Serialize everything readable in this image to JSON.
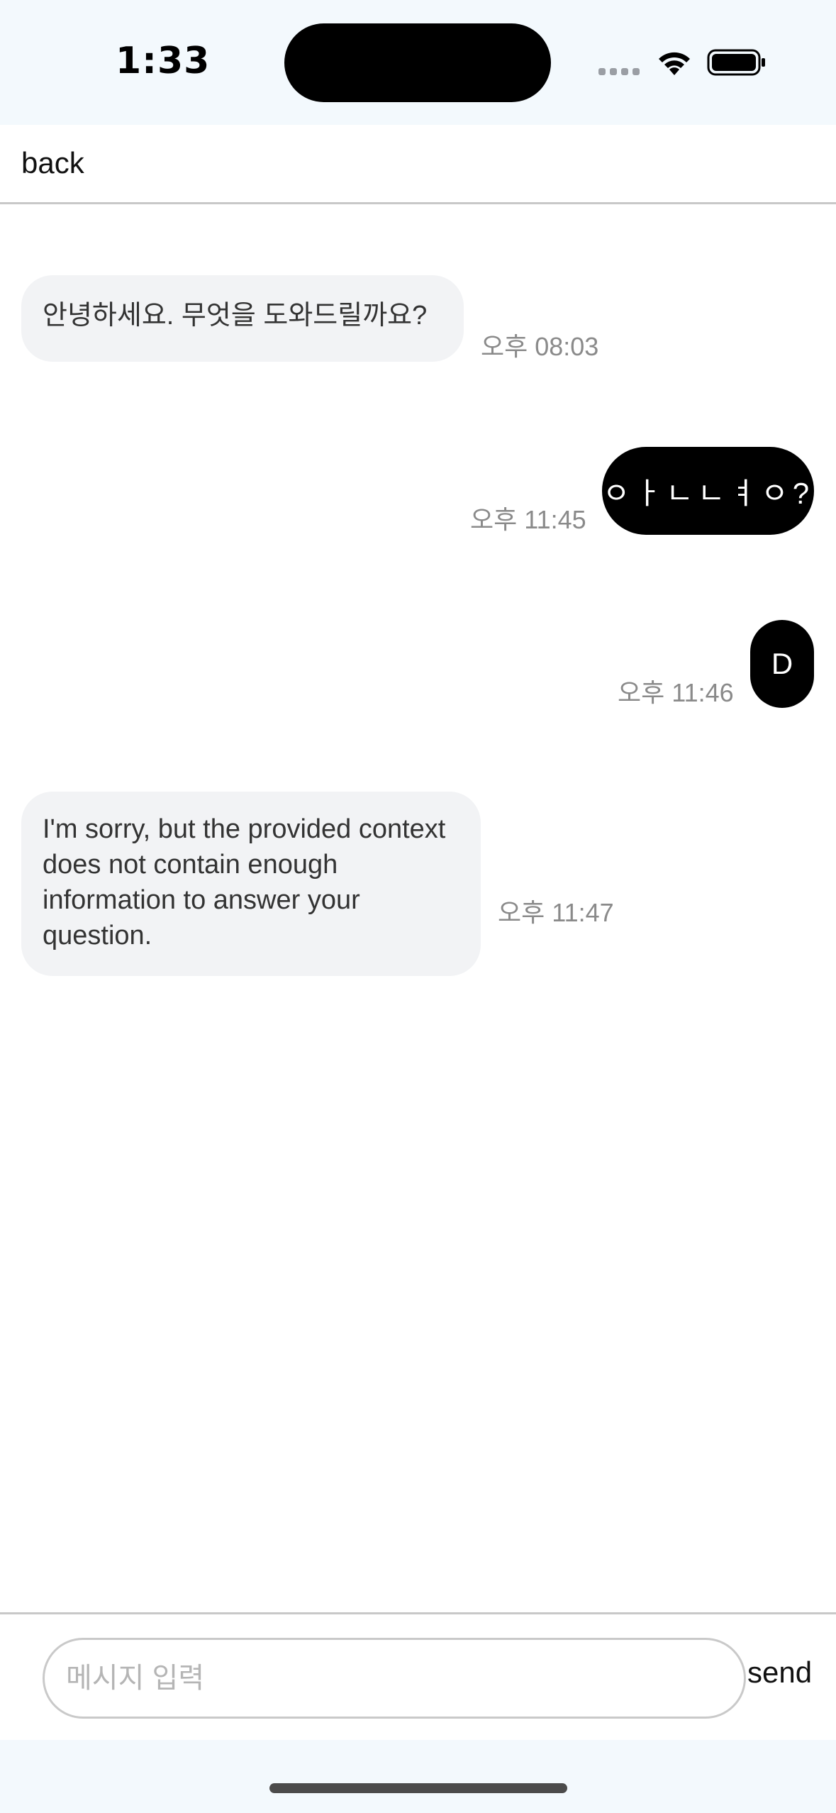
{
  "status_bar": {
    "time": "1:33"
  },
  "nav": {
    "back_label": "back"
  },
  "messages": [
    {
      "sender": "bot",
      "text": "안녕하세요. 무엇을 도와드릴까요?",
      "time": "오후 08:03"
    },
    {
      "sender": "user",
      "text": "ㅇㅏㄴㄴㅕㅇ?",
      "time": "오후 11:45"
    },
    {
      "sender": "user",
      "text": "D",
      "time": "오후 11:46"
    },
    {
      "sender": "bot",
      "text": "I'm sorry, but the provided context does not contain enough information to answer your question.",
      "time": "오후 11:47"
    }
  ],
  "composer": {
    "placeholder": "메시지 입력",
    "value": "",
    "send_label": "send"
  },
  "colors": {
    "status_bg": "#f3f9fd",
    "incoming_bubble": "#f2f3f5",
    "outgoing_bubble": "#000000",
    "timestamp": "#8a8a8a"
  }
}
